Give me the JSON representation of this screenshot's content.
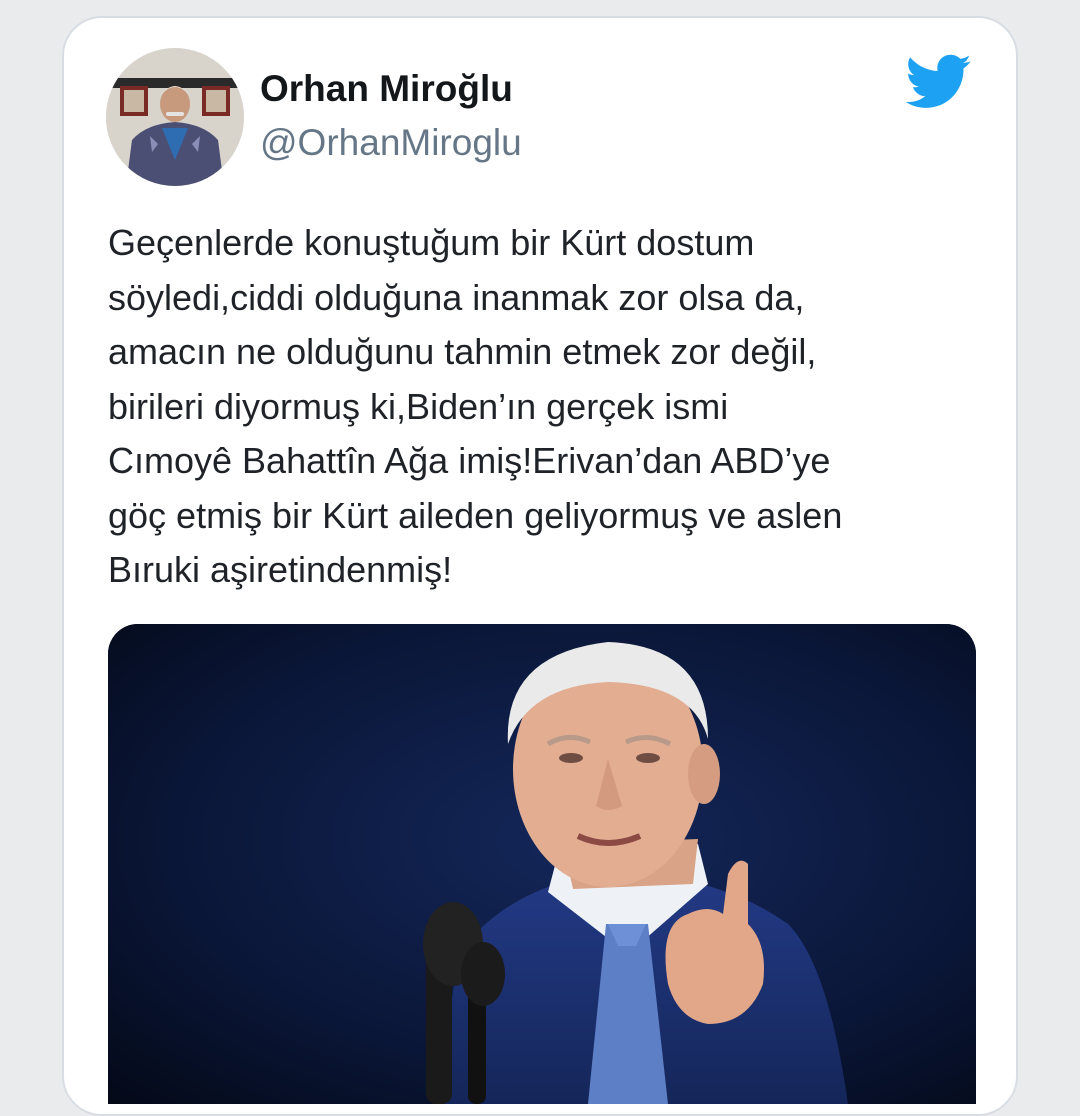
{
  "tweet": {
    "author": {
      "display_name": "Orhan Miroğlu",
      "handle": "@OrhanMiroglu"
    },
    "text": "Geçenlerde konuştuğum bir Kürt dostum\nsöyledi,ciddi olduğuna inanmak zor olsa da,\namacın ne olduğunu tahmin etmek zor değil,\nbirileri diyormuş ki,Biden’ın gerçek ismi\nCımoyê Bahattîn Ağa imiş!Erivan’dan ABD’ye\ngöç etmiş bir Kürt aileden geliyormuş ve aslen\nBıruki aşiretindenmiş!",
    "platform_icon": "twitter-bird-icon",
    "media": {
      "type": "photo",
      "subject": "man in suit gesturing at a microphone"
    }
  },
  "colors": {
    "brand": "#1da1f2",
    "name": "#14171a",
    "handle": "#657786",
    "text": "#1f2328",
    "card_border": "#d7dde3"
  }
}
